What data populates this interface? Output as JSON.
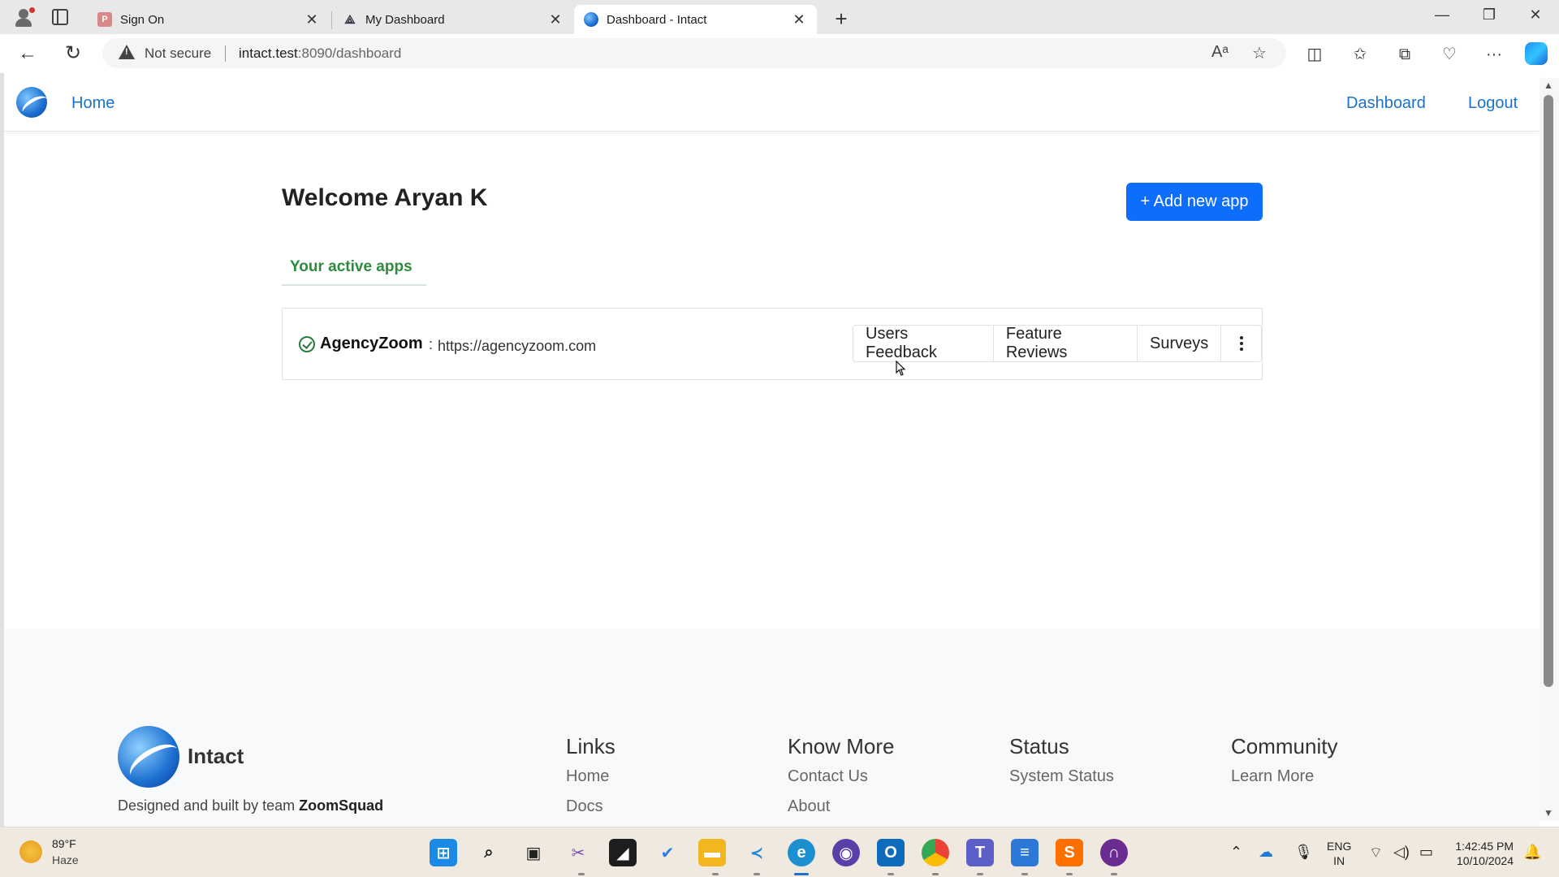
{
  "browser": {
    "tabs": [
      {
        "label": "Sign On",
        "favicon": "P"
      },
      {
        "label": "My Dashboard",
        "favicon": "A"
      },
      {
        "label": "Dashboard - Intact",
        "favicon": "intact"
      }
    ],
    "address": {
      "security": "Not secure",
      "host": "intact.test",
      "path": ":8090/dashboard"
    }
  },
  "navbar": {
    "home": "Home",
    "dashboard": "Dashboard",
    "logout": "Logout"
  },
  "main": {
    "welcome": "Welcome Aryan K",
    "add_button": "+ Add new app",
    "active_tab": "Your active apps",
    "apps": [
      {
        "name": "AgencyZoom",
        "separator": ":",
        "url": "https://agencyzoom.com",
        "actions": [
          "Users Feedback",
          "Feature Reviews",
          "Surveys"
        ]
      }
    ]
  },
  "footer": {
    "brand": "Intact",
    "credit_prefix": "Designed and built by team",
    "credit_team": "ZoomSquad",
    "columns": [
      {
        "heading": "Links",
        "links": [
          "Home",
          "Docs"
        ]
      },
      {
        "heading": "Know More",
        "links": [
          "Contact Us",
          "About"
        ]
      },
      {
        "heading": "Status",
        "links": [
          "System Status"
        ]
      },
      {
        "heading": "Community",
        "links": [
          "Learn More"
        ]
      }
    ]
  },
  "taskbar": {
    "temperature": "89°F",
    "condition": "Haze",
    "lang_line1": "ENG",
    "lang_line2": "IN",
    "time": "1:42:45 PM",
    "date": "10/10/2024"
  },
  "colors": {
    "link": "#1a73c9",
    "primary_button": "#0d6efd",
    "active_tab_text": "#2e8b3e"
  }
}
